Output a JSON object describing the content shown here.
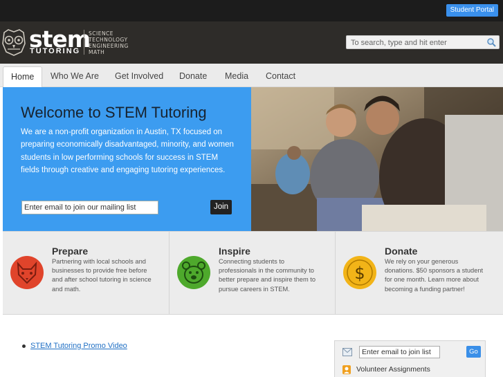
{
  "topbar": {
    "portal_label": "Student Portal"
  },
  "header": {
    "logo_word": "stem",
    "logo_tagline": "TUTORING",
    "logo_sub": [
      "SCIENCE",
      "TECHNOLOGY",
      "ENGINEERING",
      "MATH"
    ],
    "search_placeholder": "To search, type and hit enter"
  },
  "nav": {
    "items": [
      {
        "label": "Home"
      },
      {
        "label": "Who We Are"
      },
      {
        "label": "Get Involved"
      },
      {
        "label": "Donate"
      },
      {
        "label": "Media"
      },
      {
        "label": "Contact"
      }
    ]
  },
  "hero": {
    "title": "Welcome to STEM Tutoring",
    "text": "We are a non-profit organization in Austin, TX focused on preparing economically disadvantaged, minority, and women students in low performing schools for success in STEM fields through creative and engaging tutoring experiences.",
    "email_placeholder": "Enter email to join our mailing list",
    "join_label": "Join"
  },
  "features": [
    {
      "title": "Prepare",
      "text": "Partnering with local schools and businesses to provide free before and after school tutoring in science and math.",
      "icon": "fox-icon",
      "color": "#e0442b"
    },
    {
      "title": "Inspire",
      "text": "Connecting students to professionals in the community to better prepare and inspire them to pursue careers in STEM.",
      "icon": "bear-icon",
      "color": "#4ea92c"
    },
    {
      "title": "Donate",
      "text": "We rely on your generous donations. $50 sponsors a student for one month. Learn more about becoming a funding partner!",
      "icon": "dollar-icon",
      "color": "#f2b418"
    }
  ],
  "main": {
    "promo_link": "STEM Tutoring Promo Video"
  },
  "sidebox": {
    "email_placeholder": "Enter email to join list",
    "go_label": "Go",
    "volunteer_label": "Volunteer Assignments"
  }
}
